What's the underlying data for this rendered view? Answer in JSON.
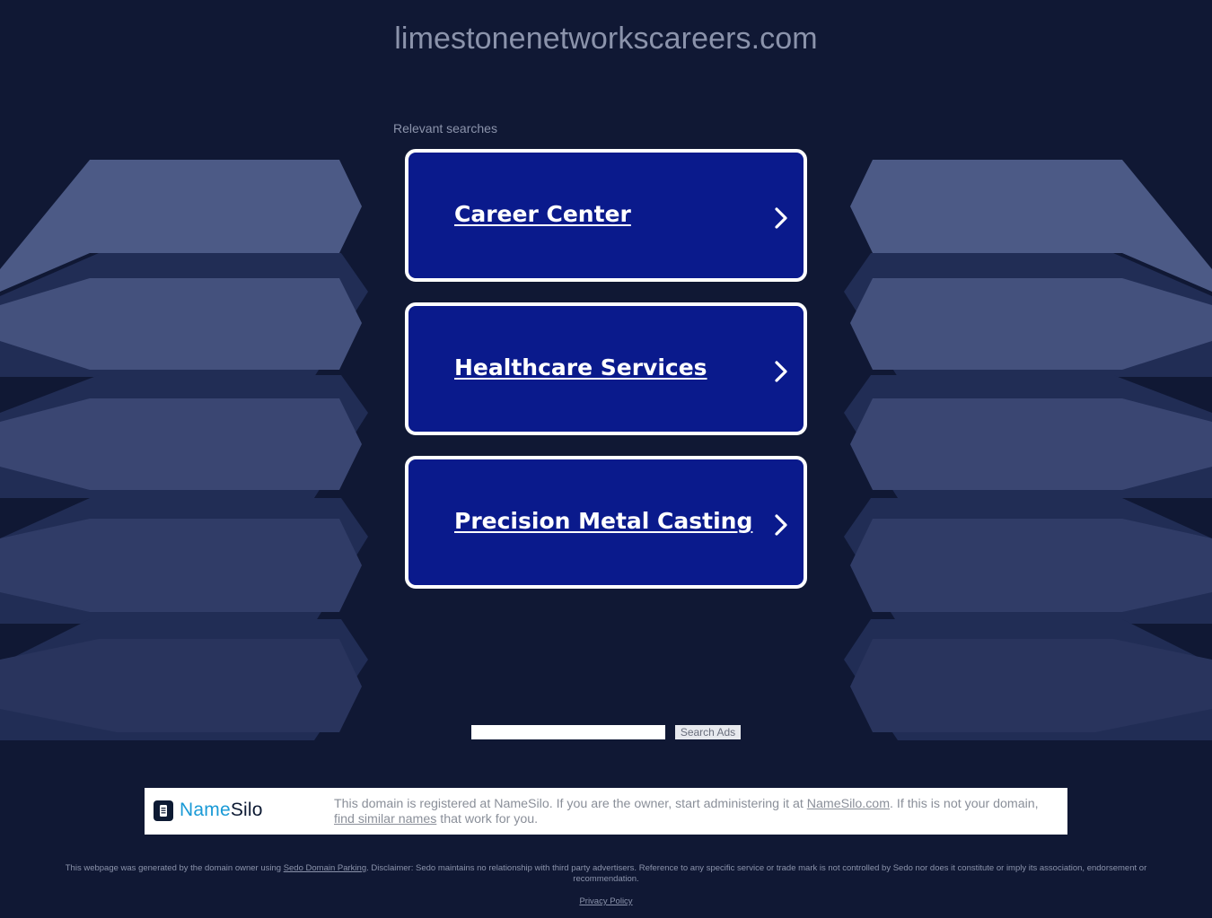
{
  "header": {
    "domain": "limestonenetworkscareers.com"
  },
  "relevant": {
    "label": "Relevant searches",
    "links": [
      {
        "label": "Career Center"
      },
      {
        "label": "Healthcare Services"
      },
      {
        "label": "Precision Metal Casting"
      }
    ]
  },
  "search": {
    "placeholder": "",
    "button_label": "Search Ads"
  },
  "registrar": {
    "logo_name": "Name",
    "logo_silo": "Silo",
    "text_1": "This domain is registered at NameSilo. If you are the owner, start administering it at ",
    "link_1": "NameSilo.com",
    "text_2": ". If this is not your domain, ",
    "link_2": "find similar names",
    "text_3": " that work for you."
  },
  "footer": {
    "text_1": "This webpage was generated by the domain owner using ",
    "link": "Sedo Domain Parking",
    "text_2": ". Disclaimer: Sedo maintains no relationship with third party advertisers. Reference to any specific service or trade mark is not controlled by Sedo nor does it constitute or imply its association, endorsement or recommendation.",
    "privacy": "Privacy Policy"
  },
  "colors": {
    "background": "#101834",
    "card_fill": "#0a1a8c",
    "card_border": "#ffffff",
    "muted_text": "#8b93ab",
    "namesilo_blue": "#1a9ad6",
    "namesilo_dark": "#0d1a33"
  },
  "icons": {
    "card_arrow": "chevron-right-icon",
    "logo": "namesilo-logo-icon"
  }
}
